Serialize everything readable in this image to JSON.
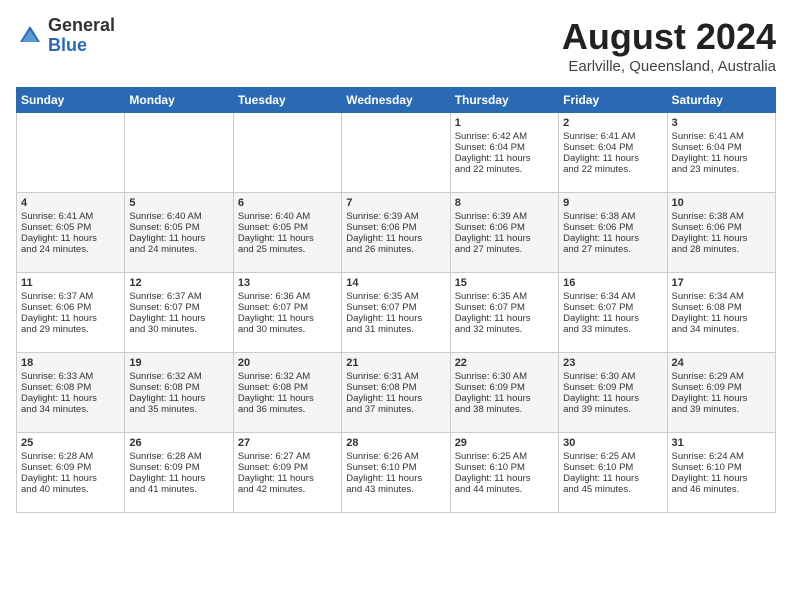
{
  "header": {
    "logo_general": "General",
    "logo_blue": "Blue",
    "month_title": "August 2024",
    "location": "Earlville, Queensland, Australia"
  },
  "days_of_week": [
    "Sunday",
    "Monday",
    "Tuesday",
    "Wednesday",
    "Thursday",
    "Friday",
    "Saturday"
  ],
  "weeks": [
    [
      {
        "day": "",
        "info": ""
      },
      {
        "day": "",
        "info": ""
      },
      {
        "day": "",
        "info": ""
      },
      {
        "day": "",
        "info": ""
      },
      {
        "day": "1",
        "info": "Sunrise: 6:42 AM\nSunset: 6:04 PM\nDaylight: 11 hours\nand 22 minutes."
      },
      {
        "day": "2",
        "info": "Sunrise: 6:41 AM\nSunset: 6:04 PM\nDaylight: 11 hours\nand 22 minutes."
      },
      {
        "day": "3",
        "info": "Sunrise: 6:41 AM\nSunset: 6:04 PM\nDaylight: 11 hours\nand 23 minutes."
      }
    ],
    [
      {
        "day": "4",
        "info": "Sunrise: 6:41 AM\nSunset: 6:05 PM\nDaylight: 11 hours\nand 24 minutes."
      },
      {
        "day": "5",
        "info": "Sunrise: 6:40 AM\nSunset: 6:05 PM\nDaylight: 11 hours\nand 24 minutes."
      },
      {
        "day": "6",
        "info": "Sunrise: 6:40 AM\nSunset: 6:05 PM\nDaylight: 11 hours\nand 25 minutes."
      },
      {
        "day": "7",
        "info": "Sunrise: 6:39 AM\nSunset: 6:06 PM\nDaylight: 11 hours\nand 26 minutes."
      },
      {
        "day": "8",
        "info": "Sunrise: 6:39 AM\nSunset: 6:06 PM\nDaylight: 11 hours\nand 27 minutes."
      },
      {
        "day": "9",
        "info": "Sunrise: 6:38 AM\nSunset: 6:06 PM\nDaylight: 11 hours\nand 27 minutes."
      },
      {
        "day": "10",
        "info": "Sunrise: 6:38 AM\nSunset: 6:06 PM\nDaylight: 11 hours\nand 28 minutes."
      }
    ],
    [
      {
        "day": "11",
        "info": "Sunrise: 6:37 AM\nSunset: 6:06 PM\nDaylight: 11 hours\nand 29 minutes."
      },
      {
        "day": "12",
        "info": "Sunrise: 6:37 AM\nSunset: 6:07 PM\nDaylight: 11 hours\nand 30 minutes."
      },
      {
        "day": "13",
        "info": "Sunrise: 6:36 AM\nSunset: 6:07 PM\nDaylight: 11 hours\nand 30 minutes."
      },
      {
        "day": "14",
        "info": "Sunrise: 6:35 AM\nSunset: 6:07 PM\nDaylight: 11 hours\nand 31 minutes."
      },
      {
        "day": "15",
        "info": "Sunrise: 6:35 AM\nSunset: 6:07 PM\nDaylight: 11 hours\nand 32 minutes."
      },
      {
        "day": "16",
        "info": "Sunrise: 6:34 AM\nSunset: 6:07 PM\nDaylight: 11 hours\nand 33 minutes."
      },
      {
        "day": "17",
        "info": "Sunrise: 6:34 AM\nSunset: 6:08 PM\nDaylight: 11 hours\nand 34 minutes."
      }
    ],
    [
      {
        "day": "18",
        "info": "Sunrise: 6:33 AM\nSunset: 6:08 PM\nDaylight: 11 hours\nand 34 minutes."
      },
      {
        "day": "19",
        "info": "Sunrise: 6:32 AM\nSunset: 6:08 PM\nDaylight: 11 hours\nand 35 minutes."
      },
      {
        "day": "20",
        "info": "Sunrise: 6:32 AM\nSunset: 6:08 PM\nDaylight: 11 hours\nand 36 minutes."
      },
      {
        "day": "21",
        "info": "Sunrise: 6:31 AM\nSunset: 6:08 PM\nDaylight: 11 hours\nand 37 minutes."
      },
      {
        "day": "22",
        "info": "Sunrise: 6:30 AM\nSunset: 6:09 PM\nDaylight: 11 hours\nand 38 minutes."
      },
      {
        "day": "23",
        "info": "Sunrise: 6:30 AM\nSunset: 6:09 PM\nDaylight: 11 hours\nand 39 minutes."
      },
      {
        "day": "24",
        "info": "Sunrise: 6:29 AM\nSunset: 6:09 PM\nDaylight: 11 hours\nand 39 minutes."
      }
    ],
    [
      {
        "day": "25",
        "info": "Sunrise: 6:28 AM\nSunset: 6:09 PM\nDaylight: 11 hours\nand 40 minutes."
      },
      {
        "day": "26",
        "info": "Sunrise: 6:28 AM\nSunset: 6:09 PM\nDaylight: 11 hours\nand 41 minutes."
      },
      {
        "day": "27",
        "info": "Sunrise: 6:27 AM\nSunset: 6:09 PM\nDaylight: 11 hours\nand 42 minutes."
      },
      {
        "day": "28",
        "info": "Sunrise: 6:26 AM\nSunset: 6:10 PM\nDaylight: 11 hours\nand 43 minutes."
      },
      {
        "day": "29",
        "info": "Sunrise: 6:25 AM\nSunset: 6:10 PM\nDaylight: 11 hours\nand 44 minutes."
      },
      {
        "day": "30",
        "info": "Sunrise: 6:25 AM\nSunset: 6:10 PM\nDaylight: 11 hours\nand 45 minutes."
      },
      {
        "day": "31",
        "info": "Sunrise: 6:24 AM\nSunset: 6:10 PM\nDaylight: 11 hours\nand 46 minutes."
      }
    ]
  ]
}
